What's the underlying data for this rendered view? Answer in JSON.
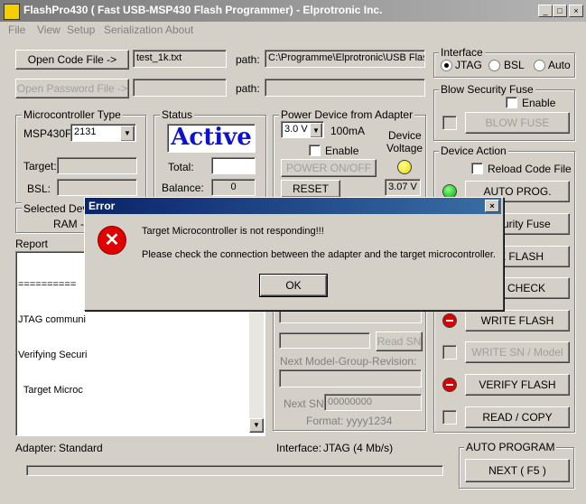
{
  "app": {
    "title": "FlashPro430  ( Fast USB-MSP430 Flash Programmer)  -  Elprotronic Inc.",
    "icon": "app-icon"
  },
  "window_buttons": {
    "minimize": "_",
    "maximize": "□",
    "close": "×"
  },
  "menu": [
    "File",
    "View",
    "Setup",
    "Serialization",
    "About"
  ],
  "files": {
    "open_code_label": "Open Code File       ->",
    "code_file": "test_1k.txt",
    "path_label": "path:",
    "code_path": "C:\\Programme\\Elprotronic\\USB Flas",
    "open_password_label": "Open Password File ->",
    "password_file": "",
    "password_path": ""
  },
  "interface": {
    "title": "Interface",
    "options": [
      "JTAG",
      "BSL",
      "Auto"
    ],
    "selected": "JTAG"
  },
  "blow_fuse": {
    "title": "Blow Security Fuse",
    "enable_label": "Enable",
    "button": "BLOW FUSE"
  },
  "microcontroller": {
    "title": "Microcontroller Type",
    "prefix": "MSP430F-",
    "selected": "2131",
    "target_label": "Target:",
    "target_value": "",
    "bsl_label": "BSL:",
    "bsl_value": ""
  },
  "status": {
    "title": "Status",
    "state": "Active",
    "total_label": "Total:",
    "total_value": "",
    "balance_label": "Balance:",
    "balance_value": "0"
  },
  "power": {
    "title": "Power Device from Adapter",
    "voltage": "3.0 V",
    "current": "100mA",
    "enable_label": "Enable",
    "device_label": "Device",
    "voltage_label": "Voltage",
    "power_button": "POWER ON/OFF",
    "reset_button": "RESET",
    "measured": "3.07 V"
  },
  "selected_device": {
    "title": "Selected Devi",
    "value": "RAM -"
  },
  "report": {
    "title": "Report",
    "lines": [
      "==========",
      "JTAG communi",
      "Verifying Securi",
      "  Target Microc"
    ]
  },
  "device_action": {
    "title": "Device Action",
    "reload_label": "Reload Code File",
    "buttons": [
      {
        "label": "AUTO PROG.",
        "status": "green"
      },
      {
        "label": "Security Fuse",
        "status": "none"
      },
      {
        "label": "SE FLASH",
        "status": "none"
      },
      {
        "label": "NK CHECK",
        "status": "none"
      },
      {
        "label": "WRITE FLASH",
        "status": "red"
      },
      {
        "label": "WRITE SN / Model",
        "status": "grey"
      },
      {
        "label": "VERIFY FLASH",
        "status": "red"
      },
      {
        "label": "READ / COPY",
        "status": "grey"
      }
    ]
  },
  "serial": {
    "read_sn": "Read SN",
    "next_model_label": "Next Model-Group-Revision:",
    "next_sn_label": "Next SN:",
    "next_sn_value": "00000000",
    "format_label": "Format: yyyy1234"
  },
  "footer": {
    "adapter_label": "Adapter:",
    "adapter_value": "Standard",
    "interface_label": "Interface:",
    "interface_value": "JTAG (4 Mb/s)",
    "auto_program_title": "AUTO PROGRAM",
    "next_button": "NEXT  ( F5 )"
  },
  "dialog": {
    "title": "Error",
    "close": "×",
    "message1": "Target Microcontroller is not responding!!!",
    "message2": "Please check the connection between the adapter and the target microcontroller.",
    "ok": "OK"
  },
  "colors": {
    "title_active": "#0a246a",
    "status_text": "#1010d0",
    "led_green": "#00aa00",
    "led_red": "#dd0000",
    "led_yellow": "#e8d800"
  }
}
